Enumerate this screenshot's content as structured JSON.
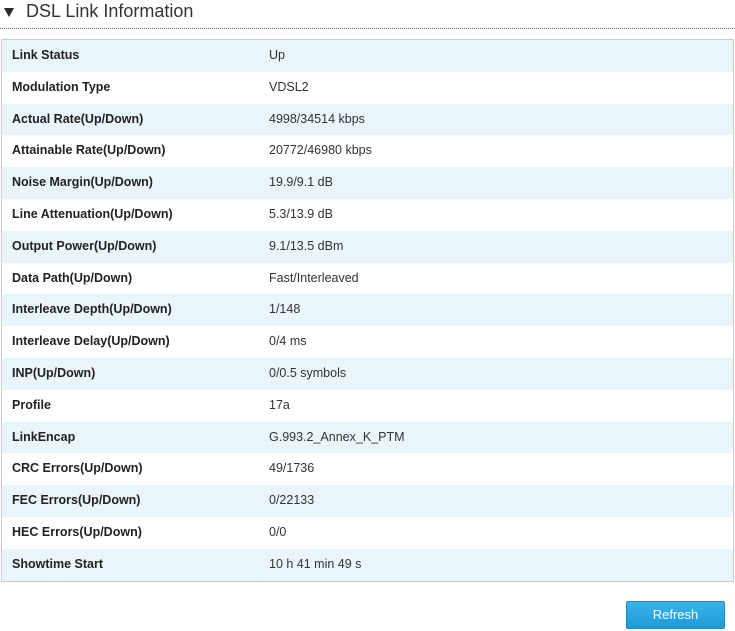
{
  "section": {
    "title": "DSL Link Information"
  },
  "rows": [
    {
      "label": "Link Status",
      "value": "Up"
    },
    {
      "label": "Modulation Type",
      "value": "VDSL2"
    },
    {
      "label": "Actual Rate(Up/Down)",
      "value": "4998/34514 kbps"
    },
    {
      "label": "Attainable Rate(Up/Down)",
      "value": "20772/46980 kbps"
    },
    {
      "label": "Noise Margin(Up/Down)",
      "value": "19.9/9.1 dB"
    },
    {
      "label": "Line Attenuation(Up/Down)",
      "value": "5.3/13.9 dB"
    },
    {
      "label": "Output Power(Up/Down)",
      "value": "9.1/13.5 dBm"
    },
    {
      "label": "Data Path(Up/Down)",
      "value": "Fast/Interleaved"
    },
    {
      "label": "Interleave Depth(Up/Down)",
      "value": "1/148"
    },
    {
      "label": "Interleave Delay(Up/Down)",
      "value": "0/4 ms"
    },
    {
      "label": "INP(Up/Down)",
      "value": "0/0.5 symbols"
    },
    {
      "label": "Profile",
      "value": "17a"
    },
    {
      "label": "LinkEncap",
      "value": "G.993.2_Annex_K_PTM"
    },
    {
      "label": "CRC Errors(Up/Down)",
      "value": "49/1736"
    },
    {
      "label": "FEC Errors(Up/Down)",
      "value": "0/22133"
    },
    {
      "label": "HEC Errors(Up/Down)",
      "value": "0/0"
    },
    {
      "label": "Showtime Start",
      "value": "10 h 41 min 49 s"
    }
  ],
  "actions": {
    "refresh_label": "Refresh"
  },
  "colors": {
    "accent": "#2aa6e0",
    "row_stripe": "#eaf4fb"
  },
  "icons": {
    "section_toggle": "caret-down-icon"
  }
}
